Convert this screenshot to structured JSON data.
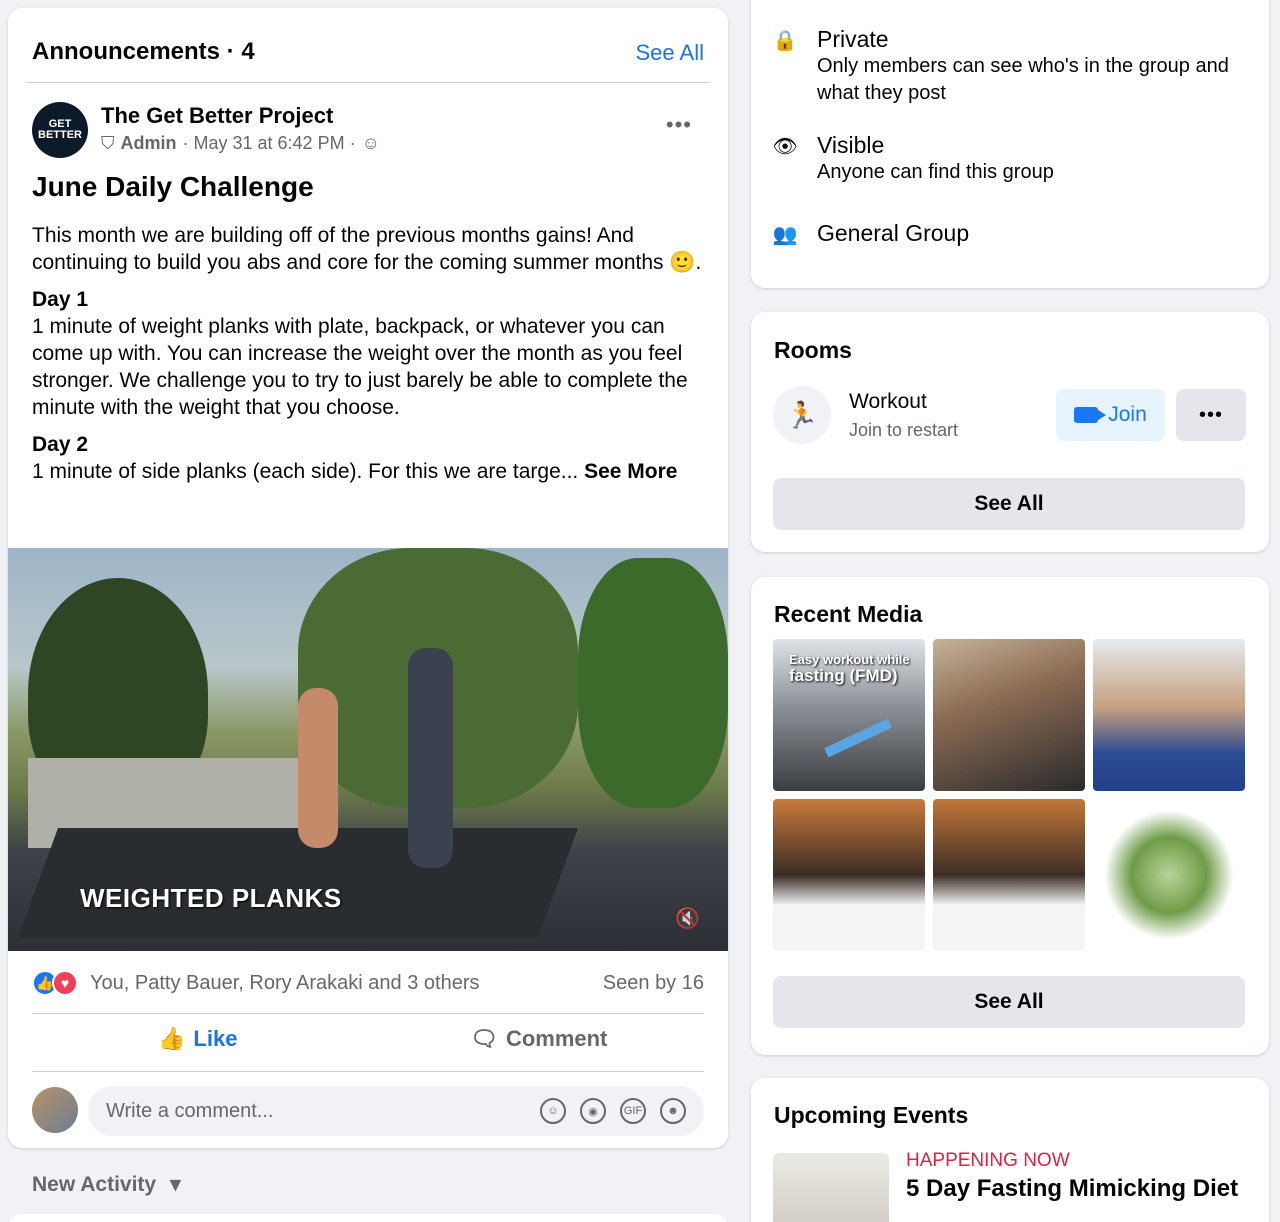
{
  "announcements": {
    "title": "Announcements · 4",
    "see_all": "See All"
  },
  "post": {
    "group_name": "The Get Better Project",
    "avatar_text": "GET BETTER",
    "role": "Admin",
    "time": "· May 31 at 6:42 PM ·",
    "title": "June Daily Challenge",
    "intro": "This month we are building off of the previous months gains! And continuing to build you abs and core for the coming summer months 🙂.",
    "day1_label": "Day 1",
    "day1_text": "1 minute of weight planks with plate, backpack, or whatever you can come up with. You can increase the weight over the month as you feel stronger. We challenge you to try to just barely be able to complete the minute with the weight that you choose.",
    "day2_label": "Day 2",
    "day2_text": "1 minute of side planks (each side). For this we are targe...",
    "see_more": "See More",
    "video_label": "WEIGHTED PLANKS",
    "reactions_text": "You, Patty Bauer, Rory Arakaki and 3 others",
    "seen_by": "Seen by 16",
    "like": "Like",
    "comment": "Comment",
    "comment_placeholder": "Write a comment..."
  },
  "new_activity": "New Activity",
  "about": {
    "private_title": "Private",
    "private_desc": "Only members can see who's in the group and what they post",
    "visible_title": "Visible",
    "visible_desc": "Anyone can find this group",
    "general": "General Group"
  },
  "rooms": {
    "title": "Rooms",
    "room_name": "Workout",
    "room_sub": "Join to restart",
    "join": "Join",
    "see_all": "See All"
  },
  "media": {
    "title": "Recent Media",
    "tile1_caption_a": "Easy workout while",
    "tile1_caption_b": "fasting (FMD)",
    "see_all": "See All"
  },
  "events": {
    "title": "Upcoming Events",
    "status": "HAPPENING NOW",
    "name": "5 Day Fasting Mimicking Diet"
  },
  "colors": {
    "accent": "#1b74e4",
    "live": "#e41e3f",
    "background": "#f0f2f5"
  }
}
